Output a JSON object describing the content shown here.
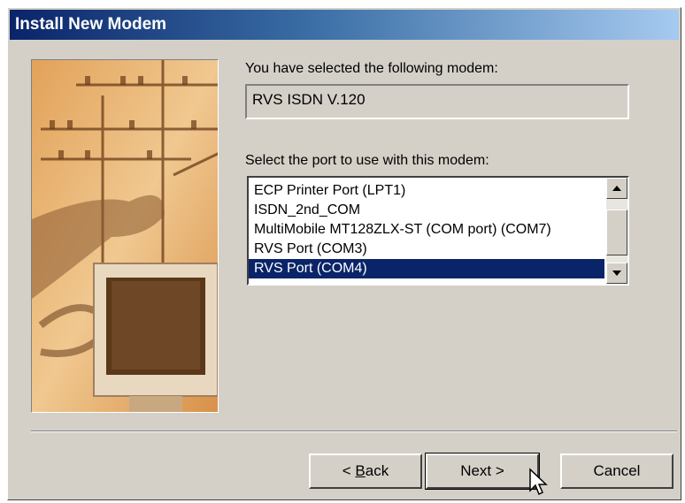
{
  "window": {
    "title": "Install New Modem"
  },
  "modem": {
    "selected_label": "You have selected the following modem:",
    "selected_value": "RVS ISDN V.120"
  },
  "ports": {
    "label": "Select the port to use with this modem:",
    "items": [
      "ECP Printer Port (LPT1)",
      "ISDN_2nd_COM",
      "MultiMobile MT128ZLX-ST (COM port) (COM7)",
      "RVS Port (COM3)",
      "RVS Port (COM4)"
    ],
    "selected_index": 4
  },
  "buttons": {
    "back_prefix": "< ",
    "back_access": "B",
    "back_rest": "ack",
    "next": "Next >",
    "cancel": "Cancel"
  },
  "icons": [
    "scroll-up-arrow-icon",
    "scroll-down-arrow-icon",
    "mouse-pointer-icon"
  ],
  "colors": {
    "selection": "#0a246a",
    "face": "#d4d0c8",
    "title_start": "#0a246a"
  }
}
